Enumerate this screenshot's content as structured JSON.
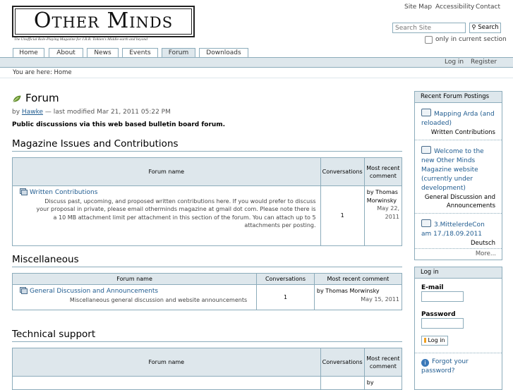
{
  "header": {
    "logo_title": "Other Minds",
    "logo_subtitle": "The Unofficial Role-Playing Magazine for J.R.R. Tolkien's Middle-earth and beyond",
    "site_actions": [
      "Site Map",
      "Accessibility",
      "Contact"
    ],
    "search": {
      "placeholder": "Search Site",
      "button_label": "Search",
      "only_current_section_label": "only in current section"
    }
  },
  "tabs": [
    {
      "label": "Home",
      "active": false
    },
    {
      "label": "About",
      "active": false
    },
    {
      "label": "News",
      "active": false
    },
    {
      "label": "Events",
      "active": false
    },
    {
      "label": "Forum",
      "active": true
    },
    {
      "label": "Downloads",
      "active": false
    }
  ],
  "personal_bar": {
    "login": "Log in",
    "register": "Register"
  },
  "breadcrumb": {
    "prefix": "You are here:",
    "home": "Home"
  },
  "main": {
    "title": "Forum",
    "byline": {
      "by": "by",
      "author": "Hawke",
      "rest": "— last modified Mar 21, 2011 05:22 PM"
    },
    "description": "Public discussions via this web based bulletin board forum.",
    "sections": [
      {
        "heading": "Magazine Issues and Contributions",
        "columns": [
          "Forum name",
          "Conversations",
          "Most recent comment"
        ],
        "rows": [
          {
            "name": "Written Contributions",
            "description": "Discuss past, upcoming, and proposed written contributions here. If you would prefer to discuss your proposal in private, please email otherminds magazine at gmail dot com. Please note there is a 10 MB attachment limit per attachment in this section of the forum. You can attach up to 5 attachments per posting.",
            "conversations": "1",
            "recent_by": "by Thomas Morwinsky",
            "recent_date": "May 22, 2011"
          }
        ]
      },
      {
        "heading": "Miscellaneous",
        "columns": [
          "Forum name",
          "Conversations",
          "Most recent comment"
        ],
        "rows": [
          {
            "name": "General Discussion and Announcements",
            "description": "Miscellaneous general discussion and website announcements",
            "conversations": "1",
            "recent_by": "by Thomas Morwinsky",
            "recent_date": "May 15, 2011"
          }
        ]
      },
      {
        "heading": "Technical support",
        "columns": [
          "Forum name",
          "Conversations",
          "Most recent comment"
        ],
        "rows": [
          {
            "recent_by": "by"
          }
        ]
      }
    ]
  },
  "portlets": {
    "recent": {
      "title": "Recent Forum Postings",
      "items": [
        {
          "title": "Mapping Arda (and reloaded)",
          "forum": "Written Contributions"
        },
        {
          "title": "Welcome to the new Other Minds Magazine website (currently under development)",
          "forum": "General Discussion and Announcements"
        },
        {
          "title": "3.MittelerdeCon am 17./18.09.2011",
          "forum": "Deutsch"
        }
      ],
      "more": "More..."
    },
    "login": {
      "title": "Log in",
      "email_label": "E-mail",
      "password_label": "Password",
      "button_label": "Log in",
      "forgot": "Forgot your password?"
    }
  }
}
